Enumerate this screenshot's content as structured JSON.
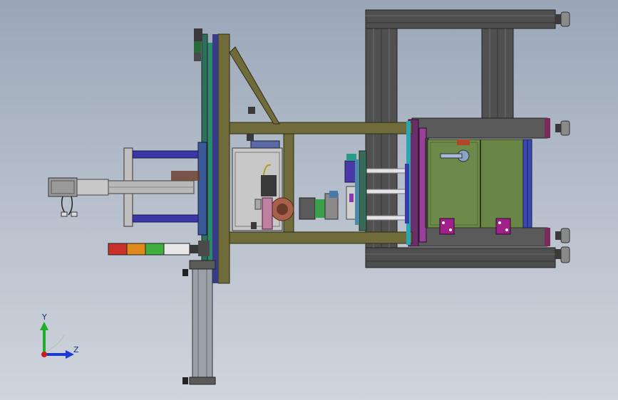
{
  "viewport": {
    "background_top": "#9aa6b8",
    "background_bottom": "#d0d5dd"
  },
  "model": {
    "frame_color": "#545454",
    "beam_color": "#6f6b3a",
    "mold_color": "#6e8a4a",
    "clamp_color": "#6a2f6a",
    "tie_bar_color": "#3a36a8",
    "accent_cyan": "#2aa6b0",
    "tower_light_colors": [
      "#c8322a",
      "#e08a1a",
      "#3fae3f",
      "#e8e8e8"
    ]
  },
  "triad": {
    "y_label": "Y",
    "z_label": "Z",
    "y_color": "#1fae2a",
    "z_color": "#1a3ad0",
    "origin_color": "#d01a1a"
  }
}
